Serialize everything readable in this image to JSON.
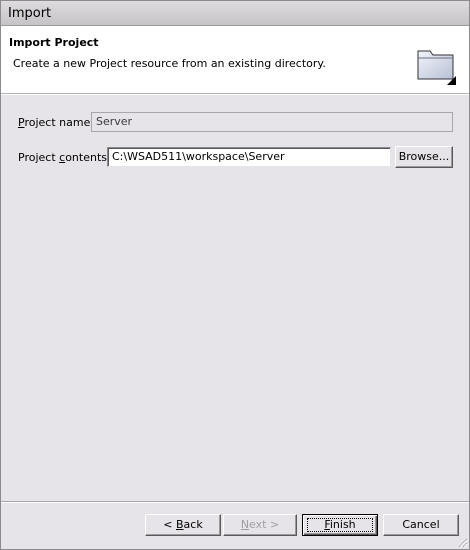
{
  "window": {
    "title": "Import"
  },
  "header": {
    "title": "Import Project",
    "description": "Create a new Project resource from an existing directory.",
    "icon": "folder-icon"
  },
  "form": {
    "project_name": {
      "label_mnemonic": "P",
      "label_rest": "roject name:",
      "value": "Server",
      "readonly": true
    },
    "project_contents": {
      "label_pre": "Project ",
      "label_mnemonic": "c",
      "label_rest": "ontents:",
      "value": "C:\\WSAD511\\workspace\\Server"
    },
    "browse_label": "Browse..."
  },
  "buttons": {
    "back_pre": "< ",
    "back_mnemonic": "B",
    "back_rest": "ack",
    "next_mnemonic": "N",
    "next_rest": "ext >",
    "finish_mnemonic": "F",
    "finish_rest": "inish",
    "cancel_label": "Cancel"
  },
  "colors": {
    "background": "#e6e4e8",
    "header_background": "#ffffff",
    "disabled_text": "#a19fa3"
  }
}
